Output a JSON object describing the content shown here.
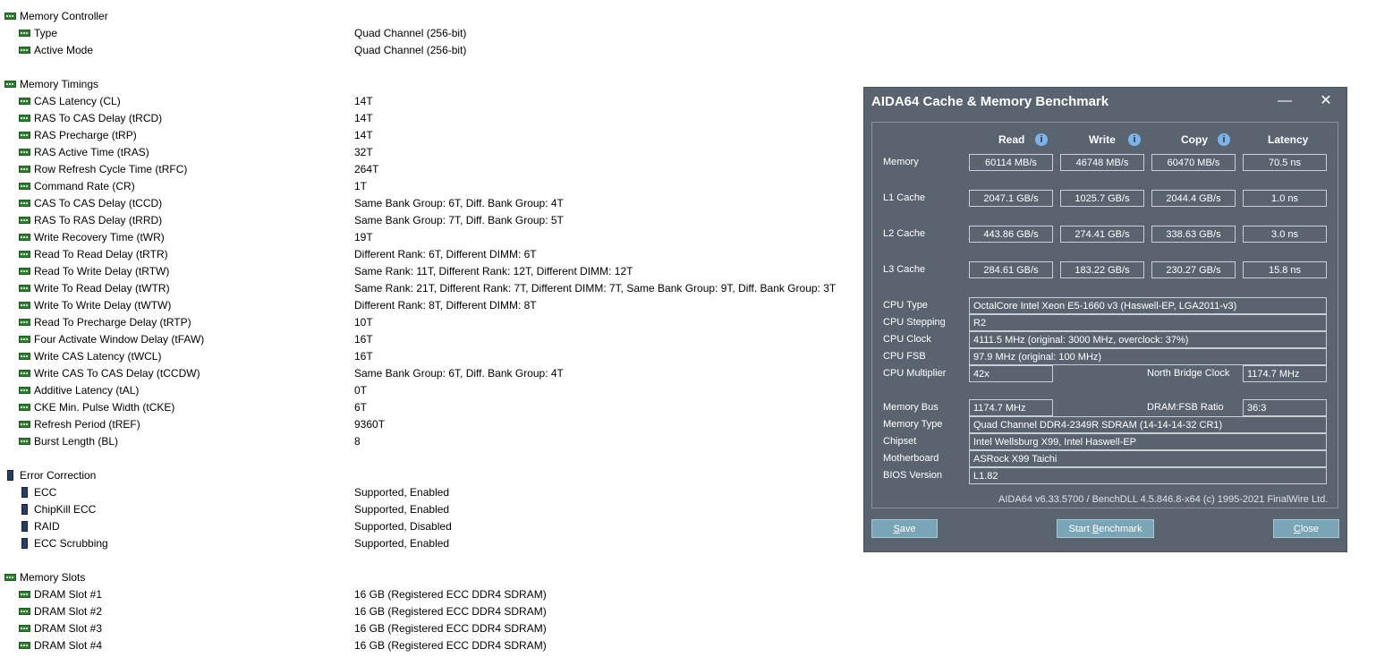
{
  "memory_controller": {
    "title": "Memory Controller",
    "rows": [
      {
        "label": "Type",
        "value": "Quad Channel  (256-bit)"
      },
      {
        "label": "Active Mode",
        "value": "Quad Channel  (256-bit)"
      }
    ]
  },
  "memory_timings": {
    "title": "Memory Timings",
    "rows": [
      {
        "label": "CAS Latency (CL)",
        "value": "14T"
      },
      {
        "label": "RAS To CAS Delay (tRCD)",
        "value": "14T"
      },
      {
        "label": "RAS Precharge (tRP)",
        "value": "14T"
      },
      {
        "label": "RAS Active Time (tRAS)",
        "value": "32T"
      },
      {
        "label": "Row Refresh Cycle Time (tRFC)",
        "value": "264T"
      },
      {
        "label": "Command Rate (CR)",
        "value": "1T"
      },
      {
        "label": "CAS To CAS Delay (tCCD)",
        "value": "Same Bank Group: 6T, Diff. Bank Group: 4T"
      },
      {
        "label": "RAS To RAS Delay (tRRD)",
        "value": "Same Bank Group: 7T, Diff. Bank Group: 5T"
      },
      {
        "label": "Write Recovery Time (tWR)",
        "value": "19T"
      },
      {
        "label": "Read To Read Delay (tRTR)",
        "value": "Different Rank: 6T, Different DIMM: 6T"
      },
      {
        "label": "Read To Write Delay (tRTW)",
        "value": "Same Rank: 11T, Different Rank: 12T, Different DIMM: 12T"
      },
      {
        "label": "Write To Read Delay (tWTR)",
        "value": "Same Rank: 21T, Different Rank: 7T, Different DIMM: 7T, Same Bank Group: 9T, Diff. Bank Group: 3T"
      },
      {
        "label": "Write To Write Delay (tWTW)",
        "value": "Different Rank: 8T, Different DIMM: 8T"
      },
      {
        "label": "Read To Precharge Delay (tRTP)",
        "value": "10T"
      },
      {
        "label": "Four Activate Window Delay (tFAW)",
        "value": "16T"
      },
      {
        "label": "Write CAS Latency (tWCL)",
        "value": "16T"
      },
      {
        "label": "Write CAS To CAS Delay (tCCDW)",
        "value": "Same Bank Group: 6T, Diff. Bank Group: 4T"
      },
      {
        "label": "Additive Latency (tAL)",
        "value": "0T"
      },
      {
        "label": "CKE Min. Pulse Width (tCKE)",
        "value": "6T"
      },
      {
        "label": "Refresh Period (tREF)",
        "value": "9360T"
      },
      {
        "label": "Burst Length (BL)",
        "value": "8"
      }
    ]
  },
  "error_correction": {
    "title": "Error Correction",
    "rows": [
      {
        "label": "ECC",
        "value": "Supported, Enabled"
      },
      {
        "label": "ChipKill ECC",
        "value": "Supported, Enabled"
      },
      {
        "label": "RAID",
        "value": "Supported, Disabled"
      },
      {
        "label": "ECC Scrubbing",
        "value": "Supported, Enabled"
      }
    ]
  },
  "memory_slots": {
    "title": "Memory Slots",
    "rows": [
      {
        "label": "DRAM Slot #1",
        "value": "16 GB  (Registered ECC DDR4 SDRAM)"
      },
      {
        "label": "DRAM Slot #2",
        "value": "16 GB  (Registered ECC DDR4 SDRAM)"
      },
      {
        "label": "DRAM Slot #3",
        "value": "16 GB  (Registered ECC DDR4 SDRAM)"
      },
      {
        "label": "DRAM Slot #4",
        "value": "16 GB  (Registered ECC DDR4 SDRAM)"
      }
    ]
  },
  "aida": {
    "title": "AIDA64 Cache & Memory Benchmark",
    "minimize": "—",
    "close_glyph": "✕",
    "headers": {
      "read": "Read",
      "write": "Write",
      "copy": "Copy",
      "latency": "Latency"
    },
    "info_glyph": "i",
    "bench": [
      {
        "label": "Memory",
        "read": "60114 MB/s",
        "write": "46748 MB/s",
        "copy": "60470 MB/s",
        "latency": "70.5 ns"
      },
      {
        "label": "L1 Cache",
        "read": "2047.1 GB/s",
        "write": "1025.7 GB/s",
        "copy": "2044.4 GB/s",
        "latency": "1.0 ns"
      },
      {
        "label": "L2 Cache",
        "read": "443.86 GB/s",
        "write": "274.41 GB/s",
        "copy": "338.63 GB/s",
        "latency": "3.0 ns"
      },
      {
        "label": "L3 Cache",
        "read": "284.61 GB/s",
        "write": "183.22 GB/s",
        "copy": "230.27 GB/s",
        "latency": "15.8 ns"
      }
    ],
    "cpu_type": {
      "label": "CPU Type",
      "value": "OctalCore Intel Xeon E5-1660 v3  (Haswell-EP, LGA2011-v3)"
    },
    "cpu_stepping": {
      "label": "CPU Stepping",
      "value": "R2"
    },
    "cpu_clock": {
      "label": "CPU Clock",
      "value": "4111.5 MHz  (original: 3000 MHz, overclock: 37%)"
    },
    "cpu_fsb": {
      "label": "CPU FSB",
      "value": "97.9 MHz  (original: 100 MHz)"
    },
    "cpu_multiplier": {
      "label": "CPU Multiplier",
      "value": "42x"
    },
    "nb_clock": {
      "label": "North Bridge Clock",
      "value": "1174.7 MHz"
    },
    "memory_bus": {
      "label": "Memory Bus",
      "value": "1174.7 MHz"
    },
    "dram_fsb": {
      "label": "DRAM:FSB Ratio",
      "value": "36:3"
    },
    "memory_type": {
      "label": "Memory Type",
      "value": "Quad Channel DDR4-2349R SDRAM  (14-14-14-32 CR1)"
    },
    "chipset": {
      "label": "Chipset",
      "value": "Intel Wellsburg X99, Intel Haswell-EP"
    },
    "motherboard": {
      "label": "Motherboard",
      "value": "ASRock X99 Taichi"
    },
    "bios": {
      "label": "BIOS Version",
      "value": "L1.82"
    },
    "footer": "AIDA64 v6.33.5700 / BenchDLL 4.5.846.8-x64  (c) 1995-2021 FinalWire Ltd.",
    "buttons": {
      "save": {
        "u": "S",
        "rest": "ave"
      },
      "start": {
        "pre": "Start ",
        "u": "B",
        "rest": "enchmark"
      },
      "close": {
        "u": "C",
        "rest": "lose"
      }
    }
  }
}
